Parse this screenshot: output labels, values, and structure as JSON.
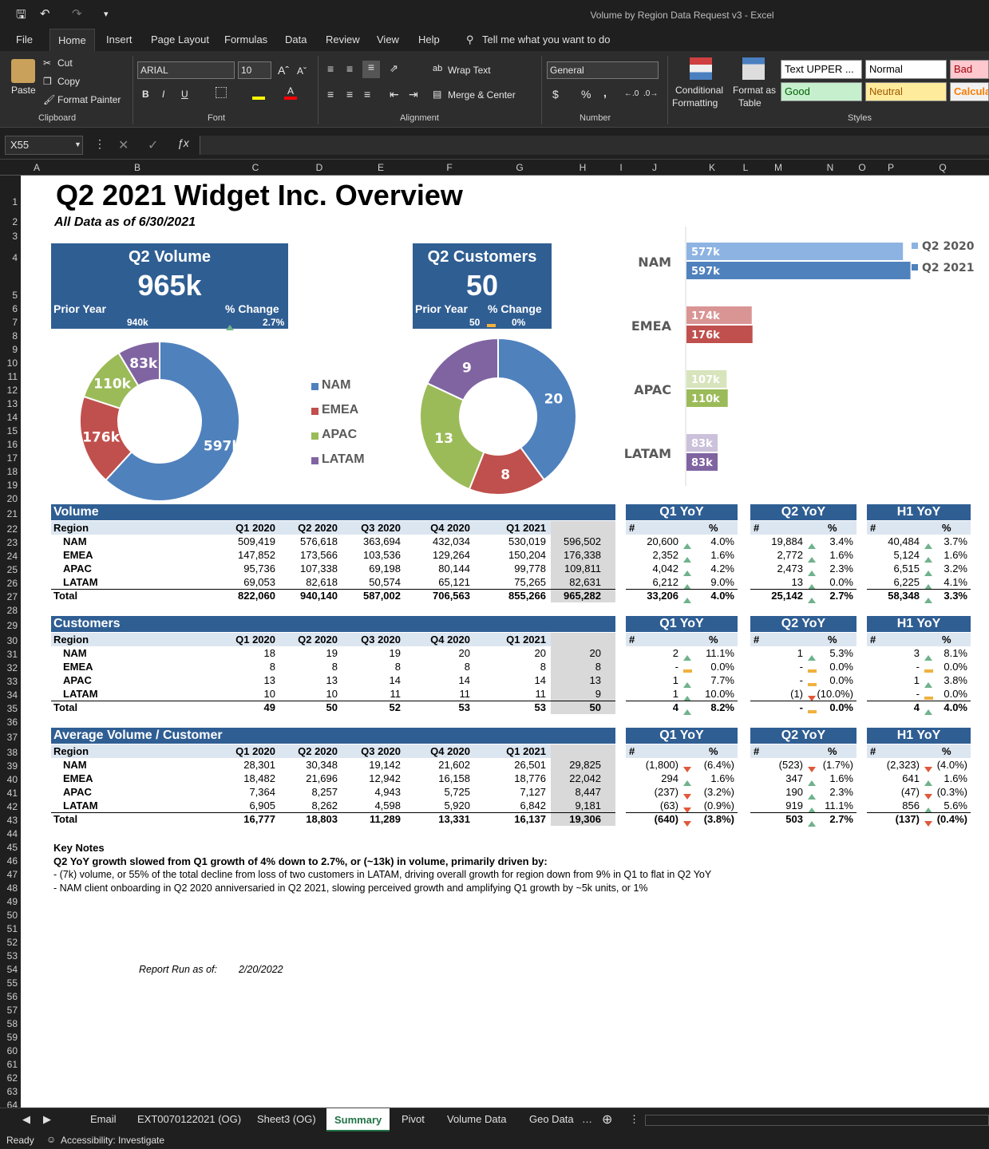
{
  "window": {
    "title": "Volume by Region Data Request v3  -  Excel"
  },
  "ribbon_tabs": [
    "File",
    "Home",
    "Insert",
    "Page Layout",
    "Formulas",
    "Data",
    "Review",
    "View",
    "Help"
  ],
  "tell_me": "Tell me what you want to do",
  "ribbon": {
    "clipboard": {
      "paste": "Paste",
      "cut": "Cut",
      "copy": "Copy",
      "format_painter": "Format Painter",
      "label": "Clipboard"
    },
    "font": {
      "name": "ARIAL",
      "size": "10",
      "label": "Font",
      "bold": "B",
      "italic": "I",
      "underline": "U"
    },
    "alignment": {
      "wrap": "Wrap Text",
      "merge": "Merge & Center",
      "label": "Alignment"
    },
    "number": {
      "format": "General",
      "label": "Number",
      "currency": "$",
      "percent": "%",
      "comma": ","
    },
    "styles": {
      "conditional": "Conditional",
      "conditional2": "Formatting",
      "format_as": "Format as",
      "format_as2": "Table",
      "label": "Styles",
      "boxes": [
        "Text UPPER ...",
        "Normal",
        "Bad",
        "Good",
        "Neutral",
        "Calcula"
      ]
    }
  },
  "namebox": "X55",
  "columns": [
    "A",
    "B",
    "C",
    "D",
    "E",
    "F",
    "G",
    "H",
    "I",
    "J",
    "K",
    "L",
    "M",
    "N",
    "O",
    "P",
    "Q"
  ],
  "rows": [
    "1",
    "2",
    "3",
    "4",
    "5",
    "6",
    "7",
    "8",
    "9",
    "10",
    "11",
    "12",
    "13",
    "14",
    "15",
    "16",
    "17",
    "18",
    "19",
    "20",
    "21",
    "22",
    "23",
    "24",
    "25",
    "26",
    "27",
    "28",
    "29",
    "30",
    "31",
    "32",
    "33",
    "34",
    "35",
    "36",
    "37",
    "38",
    "39",
    "40",
    "41",
    "42",
    "43",
    "44",
    "45",
    "46",
    "47",
    "48",
    "49",
    "50",
    "51",
    "52",
    "53",
    "54",
    "55",
    "56",
    "57",
    "58",
    "59",
    "60",
    "61",
    "62",
    "63",
    "64"
  ],
  "report": {
    "title": "Q2 2021 Widget Inc. Overview",
    "subtitle": "All Data as of 6/30/2021"
  },
  "kpi_volume": {
    "title": "Q2 Volume",
    "value": "965k",
    "prior_label": "Prior Year",
    "change_label": "% Change",
    "prior": "940k",
    "change": "2.7%"
  },
  "kpi_customers": {
    "title": "Q2 Customers",
    "value": "50",
    "prior_label": "Prior Year",
    "change_label": "% Change",
    "prior": "50",
    "change": "0%"
  },
  "colors": {
    "NAM": "#4f81bd",
    "EMEA": "#c0504d",
    "APAC": "#9bbb59",
    "LATAM": "#8064a2",
    "header": "#2f5e93"
  },
  "chart_data": [
    {
      "type": "pie",
      "subtype": "donut",
      "labels": [
        "NAM",
        "EMEA",
        "APAC",
        "LATAM"
      ],
      "values": [
        597,
        176,
        110,
        83
      ],
      "data_labels": [
        "597k",
        "176k",
        "110k",
        "83k"
      ],
      "legend": "right"
    },
    {
      "type": "pie",
      "subtype": "donut",
      "labels": [
        "NAM",
        "EMEA",
        "APAC",
        "LATAM"
      ],
      "values": [
        20,
        8,
        13,
        9
      ],
      "data_labels": [
        "20",
        "8",
        "13",
        "9"
      ]
    },
    {
      "type": "bar",
      "orientation": "horizontal",
      "categories": [
        "NAM",
        "EMEA",
        "APAC",
        "LATAM"
      ],
      "series": [
        {
          "name": "Q2 2020",
          "values": [
            577,
            174,
            107,
            83
          ],
          "labels": [
            "577k",
            "174k",
            "107k",
            "83k"
          ]
        },
        {
          "name": "Q2 2021",
          "values": [
            597,
            176,
            110,
            83
          ],
          "labels": [
            "597k",
            "176k",
            "110k",
            "83k"
          ]
        }
      ],
      "legend": "top-right",
      "xlim": [
        0,
        600
      ]
    }
  ],
  "tables": [
    {
      "title": "Volume",
      "head": [
        "Region",
        "Q1 2020",
        "Q2 2020",
        "Q3 2020",
        "Q4 2020",
        "Q1 2021",
        "Q2 2021"
      ],
      "rows": [
        [
          "NAM",
          "509,419",
          "576,618",
          "363,694",
          "432,034",
          "530,019",
          "596,502"
        ],
        [
          "EMEA",
          "147,852",
          "173,566",
          "103,536",
          "129,264",
          "150,204",
          "176,338"
        ],
        [
          "APAC",
          "95,736",
          "107,338",
          "69,198",
          "80,144",
          "99,778",
          "109,811"
        ],
        [
          "LATAM",
          "69,053",
          "82,618",
          "50,574",
          "65,121",
          "75,265",
          "82,631"
        ],
        [
          "Total",
          "822,060",
          "940,140",
          "587,002",
          "706,563",
          "855,266",
          "965,282"
        ]
      ],
      "yoy": [
        {
          "title": "Q1 YoY",
          "rows": [
            [
              "20,600",
              "up",
              "4.0%"
            ],
            [
              "2,352",
              "up",
              "1.6%"
            ],
            [
              "4,042",
              "up",
              "4.2%"
            ],
            [
              "6,212",
              "up",
              "9.0%"
            ],
            [
              "33,206",
              "up",
              "4.0%"
            ]
          ]
        },
        {
          "title": "Q2 YoY",
          "rows": [
            [
              "19,884",
              "up",
              "3.4%"
            ],
            [
              "2,772",
              "up",
              "1.6%"
            ],
            [
              "2,473",
              "up",
              "2.3%"
            ],
            [
              "13",
              "up",
              "0.0%"
            ],
            [
              "25,142",
              "up",
              "2.7%"
            ]
          ]
        },
        {
          "title": "H1 YoY",
          "rows": [
            [
              "40,484",
              "up",
              "3.7%"
            ],
            [
              "5,124",
              "up",
              "1.6%"
            ],
            [
              "6,515",
              "up",
              "3.2%"
            ],
            [
              "6,225",
              "up",
              "4.1%"
            ],
            [
              "58,348",
              "up",
              "3.3%"
            ]
          ]
        }
      ]
    },
    {
      "title": "Customers",
      "head": [
        "Region",
        "Q1 2020",
        "Q2 2020",
        "Q3 2020",
        "Q4 2020",
        "Q1 2021",
        "Q2 2021"
      ],
      "rows": [
        [
          "NAM",
          "18",
          "19",
          "19",
          "20",
          "20",
          "20"
        ],
        [
          "EMEA",
          "8",
          "8",
          "8",
          "8",
          "8",
          "8"
        ],
        [
          "APAC",
          "13",
          "13",
          "14",
          "14",
          "14",
          "13"
        ],
        [
          "LATAM",
          "10",
          "10",
          "11",
          "11",
          "11",
          "9"
        ],
        [
          "Total",
          "49",
          "50",
          "52",
          "53",
          "53",
          "50"
        ]
      ],
      "yoy": [
        {
          "title": "Q1 YoY",
          "rows": [
            [
              "2",
              "up",
              "11.1%"
            ],
            [
              "-",
              "flat",
              "0.0%"
            ],
            [
              "1",
              "up",
              "7.7%"
            ],
            [
              "1",
              "up",
              "10.0%"
            ],
            [
              "4",
              "up",
              "8.2%"
            ]
          ]
        },
        {
          "title": "Q2 YoY",
          "rows": [
            [
              "1",
              "up",
              "5.3%"
            ],
            [
              "-",
              "flat",
              "0.0%"
            ],
            [
              "-",
              "flat",
              "0.0%"
            ],
            [
              "(1)",
              "down",
              "(10.0%)"
            ],
            [
              "-",
              "flat",
              "0.0%"
            ]
          ]
        },
        {
          "title": "H1 YoY",
          "rows": [
            [
              "3",
              "up",
              "8.1%"
            ],
            [
              "-",
              "flat",
              "0.0%"
            ],
            [
              "1",
              "up",
              "3.8%"
            ],
            [
              "-",
              "flat",
              "0.0%"
            ],
            [
              "4",
              "up",
              "4.0%"
            ]
          ]
        }
      ]
    },
    {
      "title": "Average Volume / Customer",
      "head": [
        "Region",
        "Q1 2020",
        "Q2 2020",
        "Q3 2020",
        "Q4 2020",
        "Q1 2021",
        "Q2 2021"
      ],
      "rows": [
        [
          "NAM",
          "28,301",
          "30,348",
          "19,142",
          "21,602",
          "26,501",
          "29,825"
        ],
        [
          "EMEA",
          "18,482",
          "21,696",
          "12,942",
          "16,158",
          "18,776",
          "22,042"
        ],
        [
          "APAC",
          "7,364",
          "8,257",
          "4,943",
          "5,725",
          "7,127",
          "8,447"
        ],
        [
          "LATAM",
          "6,905",
          "8,262",
          "4,598",
          "5,920",
          "6,842",
          "9,181"
        ],
        [
          "Total",
          "16,777",
          "18,803",
          "11,289",
          "13,331",
          "16,137",
          "19,306"
        ]
      ],
      "yoy": [
        {
          "title": "Q1 YoY",
          "rows": [
            [
              "(1,800)",
              "down",
              "(6.4%)"
            ],
            [
              "294",
              "up",
              "1.6%"
            ],
            [
              "(237)",
              "down",
              "(3.2%)"
            ],
            [
              "(63)",
              "down",
              "(0.9%)"
            ],
            [
              "(640)",
              "down",
              "(3.8%)"
            ]
          ]
        },
        {
          "title": "Q2 YoY",
          "rows": [
            [
              "(523)",
              "down",
              "(1.7%)"
            ],
            [
              "347",
              "up",
              "1.6%"
            ],
            [
              "190",
              "up",
              "2.3%"
            ],
            [
              "919",
              "up",
              "11.1%"
            ],
            [
              "503",
              "up",
              "2.7%"
            ]
          ]
        },
        {
          "title": "H1 YoY",
          "rows": [
            [
              "(2,323)",
              "down",
              "(4.0%)"
            ],
            [
              "641",
              "up",
              "1.6%"
            ],
            [
              "(47)",
              "down",
              "(0.3%)"
            ],
            [
              "856",
              "up",
              "5.6%"
            ],
            [
              "(137)",
              "down",
              "(0.4%)"
            ]
          ]
        }
      ]
    }
  ],
  "yoy_head": [
    "#",
    "%"
  ],
  "notes": {
    "title": "Key Notes",
    "lead": "Q2 YoY growth slowed from Q1 growth of 4% down to 2.7%, or (~13k) in volume, primarily driven by:",
    "lines": [
      "- (7k) volume, or 55% of the total decline from loss of two customers in LATAM, driving overall growth for region down from 9% in Q1 to flat in Q2 YoY",
      "- NAM client onboarding in Q2 2020 anniversaried in Q2 2021, slowing perceived growth and amplifying Q1 growth by ~5k units, or 1%"
    ]
  },
  "report_run": {
    "label": "Report Run as of:",
    "date": "2/20/2022"
  },
  "sheet_tabs": [
    "Email",
    "EXT0070122021 (OG)",
    "Sheet3 (OG)",
    "Summary",
    "Pivot",
    "Volume Data",
    "Geo Data"
  ],
  "status": {
    "ready": "Ready",
    "accessibility": "Accessibility: Investigate"
  }
}
